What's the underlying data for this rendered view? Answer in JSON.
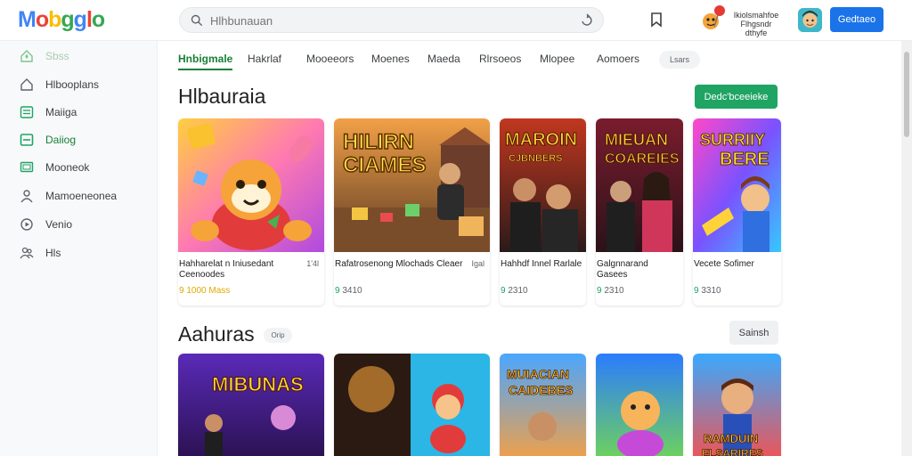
{
  "header": {
    "logo_letters": [
      "M",
      "o",
      "b",
      "g",
      "g",
      "l",
      "o"
    ],
    "logo_colors": [
      "#4285f4",
      "#ea4335",
      "#fbbc05",
      "#34a853",
      "#4285f4",
      "#ea4335",
      "#34a853"
    ],
    "search_placeholder": "Hlhbunauan",
    "notification_text": "Ikiolsmahfoe Flhgsndr dthyfe",
    "signin_label": "Gedtaeo"
  },
  "sidebar": {
    "items": [
      {
        "label": "Sbss",
        "icon": "home-icon",
        "active": true
      },
      {
        "label": "Hlbooplans",
        "icon": "home-outline-icon",
        "active": false
      },
      {
        "label": "Maiiga",
        "icon": "list-icon",
        "active": false
      },
      {
        "label": "Daiiog",
        "icon": "grid-icon",
        "active": true
      },
      {
        "label": "Mooneok",
        "icon": "monitor-icon",
        "active": false
      },
      {
        "label": "Mamoeneonea",
        "icon": "person-icon",
        "active": false
      },
      {
        "label": "Venio",
        "icon": "video-icon",
        "active": false
      },
      {
        "label": "Hls",
        "icon": "people-icon",
        "active": false
      }
    ]
  },
  "tabs": {
    "items": [
      "Hnbigmale",
      "Hakrlaf",
      "Mooeeors",
      "Moenes",
      "Maeda",
      "Rlrsoeos",
      "Mlopee",
      "Aomoers"
    ],
    "pill": "Lsars"
  },
  "section1": {
    "title": "Hlbauraia",
    "button": "Dedc'bceeieke",
    "cards": [
      {
        "title": "Hahharelat n Iniusedant Ceenoodes",
        "side": "1'4l",
        "meta": "9 1000 Mass",
        "meta_color": "yellow"
      },
      {
        "title": "Rafatrosenong Mlochads Cleaer",
        "side": "Igal",
        "meta": "9 3410",
        "meta_color": "green"
      },
      {
        "title": "Hahhdf Innel Rarlale",
        "side": "",
        "meta": "9 2310",
        "meta_color": "green"
      },
      {
        "title": "Galgnnarand Gasees",
        "side": "",
        "meta": "9 2310",
        "meta_color": "green"
      },
      {
        "title": "Vecete Sofimer",
        "side": "",
        "meta": "9 3310",
        "meta_color": "green"
      }
    ]
  },
  "section2": {
    "title": "Aahuras",
    "badge": "Orip",
    "button": "Sainsh"
  },
  "thumb_text": {
    "c1": "",
    "c2a": "HILIRN",
    "c2b": "CIAMES",
    "c3a": "MAROIN",
    "c3b": "CJBNBERS",
    "c4a": "MIEUAN",
    "c4b": "COAREIES",
    "c5a": "SURRIIY",
    "c5b": "BERE",
    "b1a": "MIBUNAS",
    "b3a": "MUIACIAN",
    "b3b": "CAIDEBES",
    "b5a": "RAMDUIN",
    "b5b": "ELSARIRES"
  }
}
